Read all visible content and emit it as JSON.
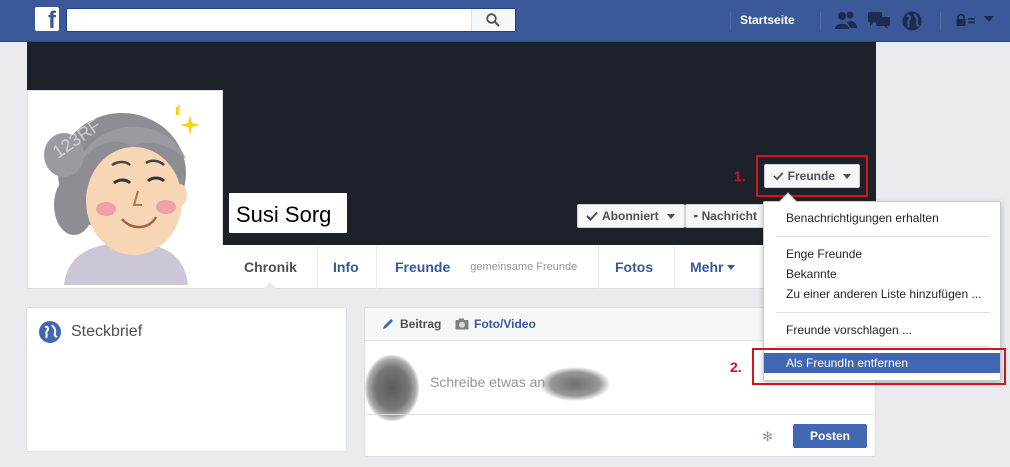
{
  "topbar": {
    "logo": "f",
    "search_placeholder": "",
    "home_label": "Startseite",
    "icons": [
      "friend-requests-icon",
      "messages-icon",
      "notifications-globe-icon",
      "privacy-lock-icon",
      "account-menu-caret-icon"
    ]
  },
  "profile": {
    "name": "Susi Sorg",
    "watermark": "123RF"
  },
  "cover_buttons": {
    "friends_label": "Freunde",
    "follow_label": "Abonniert",
    "message_label": "Nachricht"
  },
  "annotations": {
    "step1": "1.",
    "step2": "2."
  },
  "tabs": {
    "timeline": "Chronik",
    "about": "Info",
    "friends": "Freunde",
    "friends_sub": "gemeinsame Freunde",
    "photos": "Fotos",
    "more": "Mehr"
  },
  "intro": {
    "title": "Steckbrief"
  },
  "composer": {
    "post_tab": "Beitrag",
    "photo_tab": "Foto/Video",
    "placeholder": "Schreibe etwas an",
    "submit_label": "Posten"
  },
  "friends_menu": {
    "items": [
      "Benachrichtigungen erhalten",
      "Enge Freunde",
      "Bekannte",
      "Zu einer anderen Liste hinzufügen ...",
      "Freunde vorschlagen ...",
      "Als FreundIn entfernen"
    ],
    "highlighted_index": 5
  },
  "colors": {
    "brand": "#3b5998",
    "link": "#365899",
    "annotation": "#d1131c",
    "highlight": "#4267b2"
  }
}
